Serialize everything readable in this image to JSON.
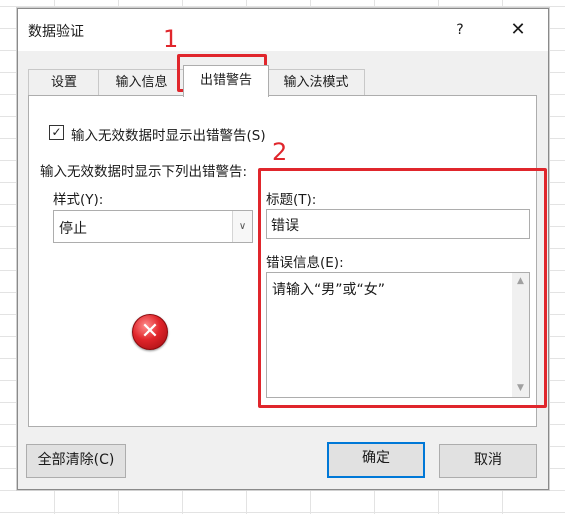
{
  "dialog": {
    "title": "数据验证",
    "help_label": "?",
    "close_label": "✕"
  },
  "tabs": [
    {
      "label": "设置"
    },
    {
      "label": "输入信息"
    },
    {
      "label": "出错警告",
      "selected": true
    },
    {
      "label": "输入法模式"
    }
  ],
  "error_alert": {
    "show_checkbox_label": "输入无效数据时显示出错警告(S)",
    "show_checkbox_checked": true,
    "section_label": "输入无效数据时显示下列出错警告:",
    "style_label": "样式(Y):",
    "style_value": "停止",
    "style_icon": "error-stop-icon",
    "title_label": "标题(T):",
    "title_value": "错误",
    "message_label": "错误信息(E):",
    "message_value": "请输入“男”或“女”"
  },
  "buttons": {
    "clear_all": "全部清除(C)",
    "ok": "确定",
    "cancel": "取消"
  },
  "annotations": {
    "marker_1": "1",
    "marker_2": "2",
    "color": "#e0262c"
  }
}
